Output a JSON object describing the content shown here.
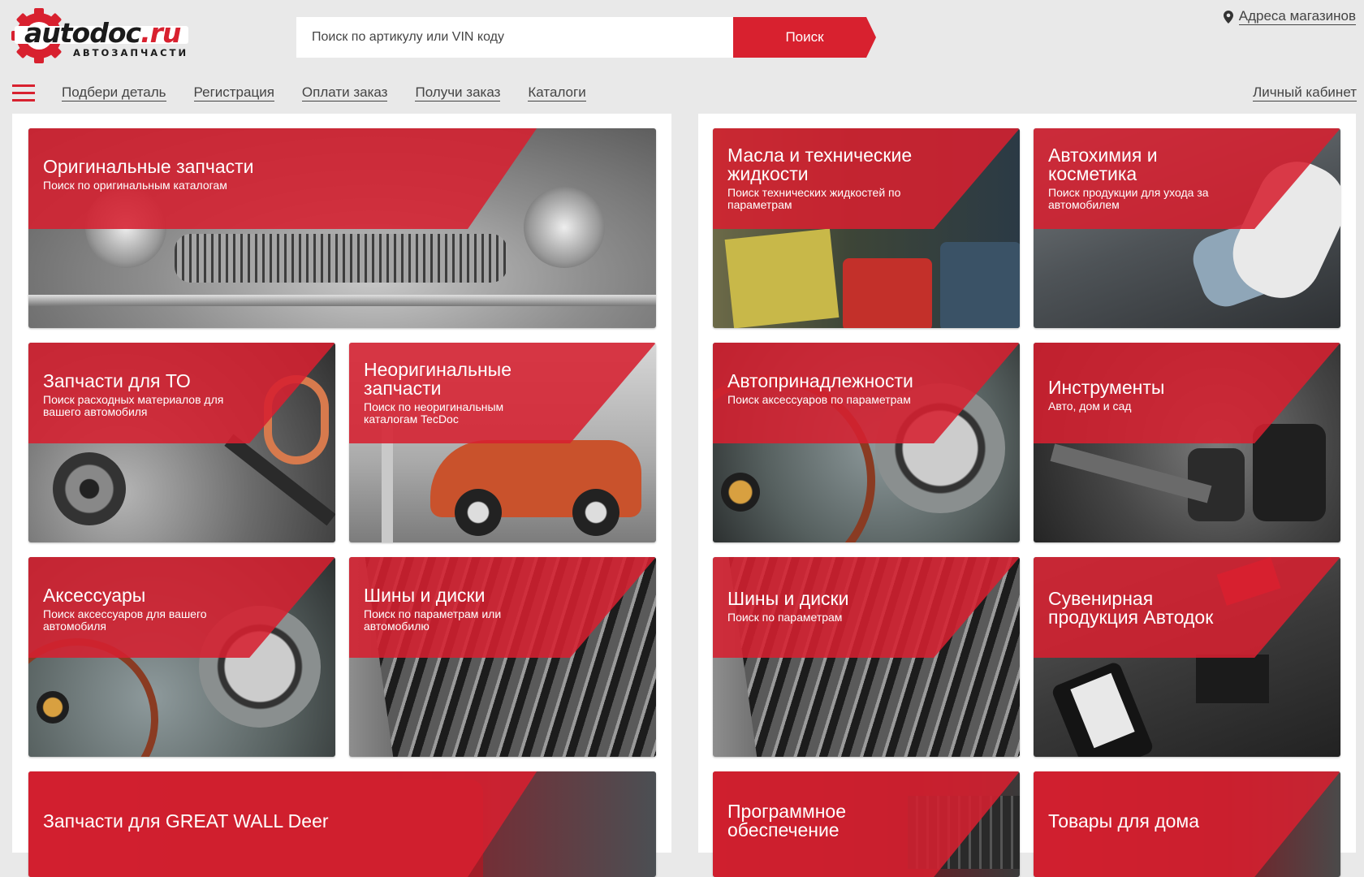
{
  "header": {
    "logo_word_left": "autodoc",
    "logo_word_right": ".ru",
    "logo_subtitle": "АВТОЗАПЧАСТИ",
    "search_placeholder": "Поиск по артикулу или VIN коду",
    "search_button": "Поиск",
    "stores_link": "Адреса магазинов",
    "cabinet_link": "Личный кабинет"
  },
  "nav": {
    "items": [
      "Подбери деталь",
      "Регистрация",
      "Оплати заказ",
      "Получи заказ",
      "Каталоги"
    ]
  },
  "left_tiles": [
    {
      "title": "Оригинальные запчасти",
      "subtitle": "Поиск по оригинальным каталогам",
      "image": "vintage-car-front"
    },
    {
      "title": "Запчасти для ТО",
      "subtitle": "Поиск расходных материалов для вашего автомобиля",
      "image": "maintenance-parts"
    },
    {
      "title": "Неоригинальные запчасти",
      "subtitle": "Поиск по неоригинальным каталогам TecDoc",
      "image": "orange-car-lift"
    },
    {
      "title": "Аксессуары",
      "subtitle": "Поиск аксессуаров для вашего автомобиля",
      "image": "dashboard-gauges"
    },
    {
      "title": "Шины и диски",
      "subtitle": "Поиск по параметрам или автомобилю",
      "image": "tire-tread"
    },
    {
      "title": "Запчасти для GREAT WALL Deer",
      "subtitle": "",
      "image": "red-suv"
    }
  ],
  "right_tiles": [
    {
      "title": "Масла и технические жидкости",
      "subtitle": "Поиск технических жидкостей по параметрам",
      "image": "oil-cans"
    },
    {
      "title": "Автохимия и косметика",
      "subtitle": "Поиск продукции для ухода за автомобилем",
      "image": "car-polishing"
    },
    {
      "title": "Автопринадлежности",
      "subtitle": "Поиск аксессуаров по параметрам",
      "image": "dashboard-gauges"
    },
    {
      "title": "Инструменты",
      "subtitle": "Авто, дом и сад",
      "image": "socket-tools"
    },
    {
      "title": "Шины и диски",
      "subtitle": "Поиск по параметрам",
      "image": "tire-tread"
    },
    {
      "title": "Сувенирная продукция Автодок",
      "subtitle": "",
      "image": "phone-souvenirs"
    },
    {
      "title": "Программное обеспечение",
      "subtitle": "",
      "image": "software-keyboard"
    },
    {
      "title": "Товары для дома",
      "subtitle": "",
      "image": "home-goods"
    }
  ],
  "colors": {
    "brand_red": "#d8212f",
    "band_red": "#d62030",
    "page_bg": "#e9e9e9"
  }
}
